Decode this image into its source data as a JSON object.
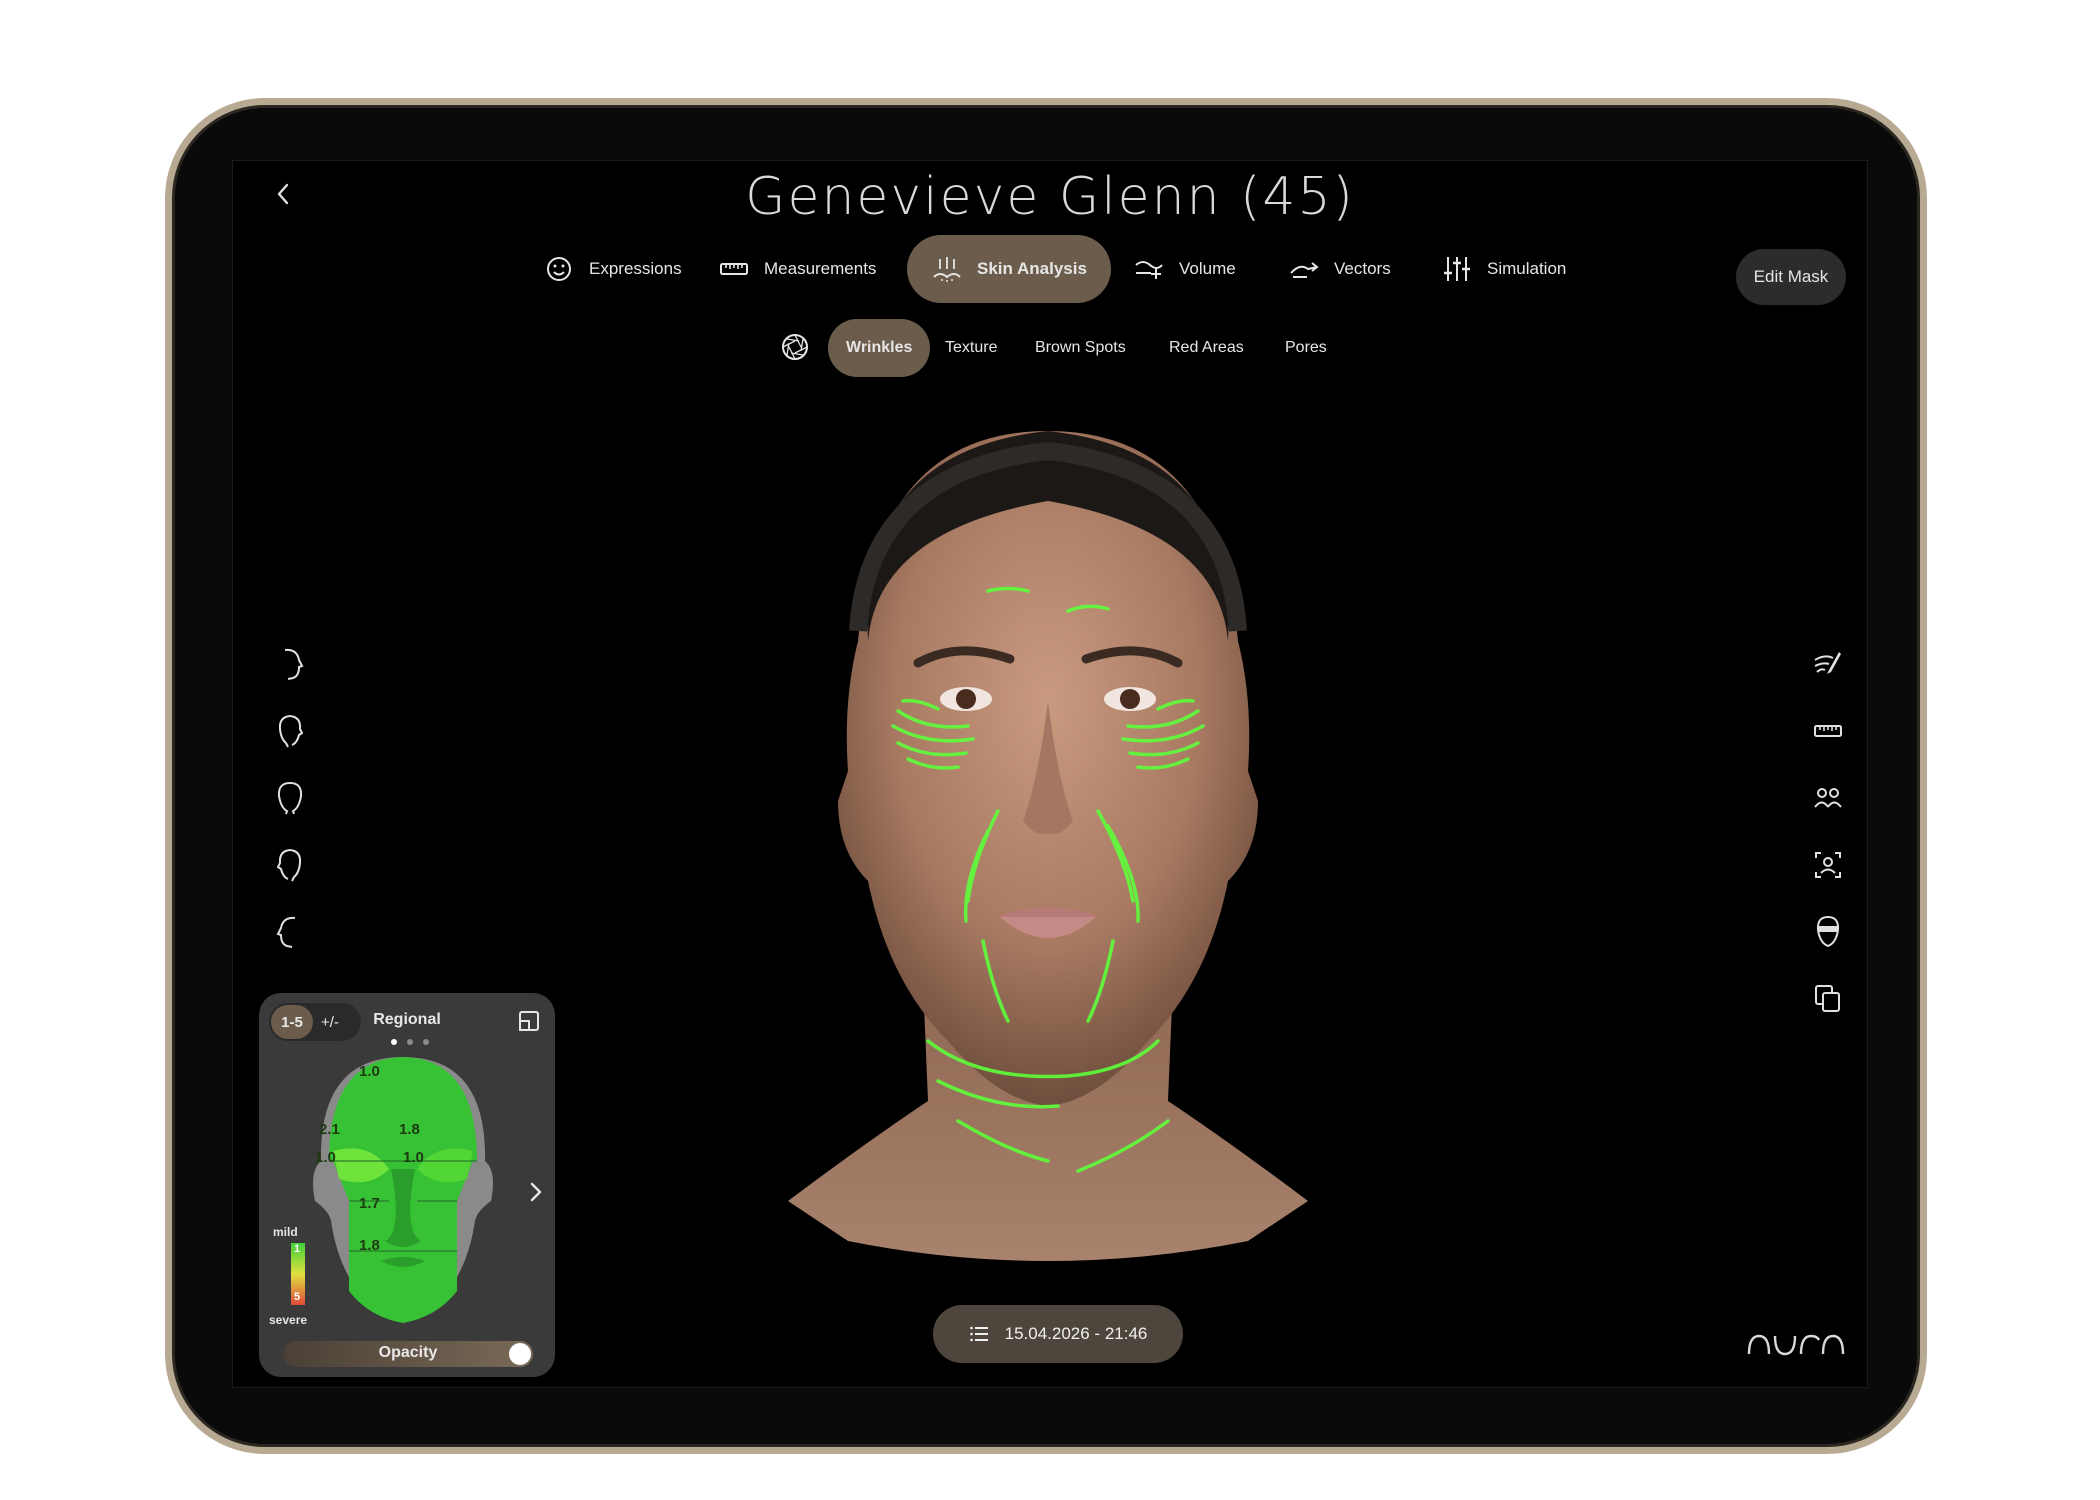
{
  "patient": {
    "title": "Genevieve Glenn (45)"
  },
  "tabs": [
    {
      "label": "Expressions",
      "icon": "smiley-icon"
    },
    {
      "label": "Measurements",
      "icon": "ruler-icon"
    },
    {
      "label": "Skin Analysis",
      "icon": "skin-icon",
      "active": true
    },
    {
      "label": "Volume",
      "icon": "volume-icon"
    },
    {
      "label": "Vectors",
      "icon": "vectors-icon"
    },
    {
      "label": "Simulation",
      "icon": "sliders-icon"
    }
  ],
  "edit_mask": {
    "label": "Edit Mask"
  },
  "subtabs": [
    {
      "label": "Wrinkles",
      "active": true
    },
    {
      "label": "Texture"
    },
    {
      "label": "Brown Spots"
    },
    {
      "label": "Red Areas"
    },
    {
      "label": "Pores"
    }
  ],
  "left_views": [
    "profile-right-icon",
    "three-quarter-right-icon",
    "front-head-icon",
    "three-quarter-left-icon",
    "profile-left-icon"
  ],
  "right_tools": [
    "brush-icon",
    "ruler-icon",
    "compare-people-icon",
    "face-scan-icon",
    "mask-icon",
    "copy-icon"
  ],
  "panel": {
    "scale_label": "1-5",
    "diff_label": "+/-",
    "title": "Regional",
    "legend_top": "mild",
    "legend_bottom": "severe",
    "legend_min": "1",
    "legend_max": "5",
    "opacity_label": "Opacity",
    "opacity_value": 1.0,
    "regions": {
      "forehead": "1.0",
      "eye_left": "2.1",
      "eye_right": "1.8",
      "cheek_left": "1.0",
      "cheek_right": "1.0",
      "mouth": "1.7",
      "chin": "1.8"
    },
    "page_dots": 3
  },
  "footer": {
    "timestamp": "15.04.2026 - 21:46"
  },
  "brand": {
    "logo": "AURA"
  },
  "colors": {
    "accent": "#6b5c4b",
    "wrinkle": "#5dff3a",
    "bezel": "#b8a992"
  }
}
